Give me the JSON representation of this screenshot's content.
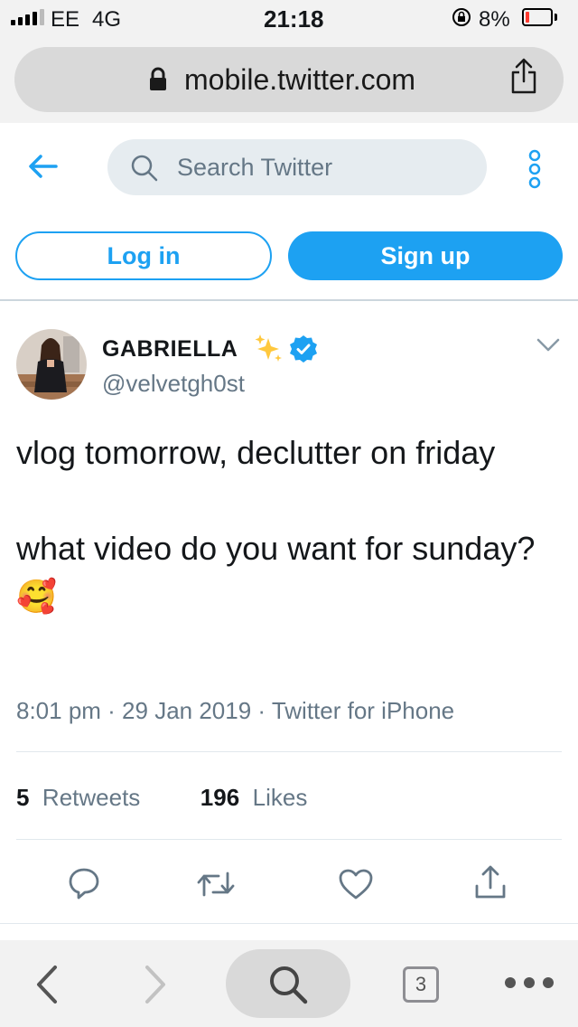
{
  "status_bar": {
    "carrier": "EE",
    "network": "4G",
    "time": "21:18",
    "battery": "8%"
  },
  "browser": {
    "url": "mobile.twitter.com",
    "tab_count": "3"
  },
  "header": {
    "search_placeholder": "Search Twitter",
    "login_label": "Log in",
    "signup_label": "Sign up"
  },
  "tweet": {
    "display_name": "GABRIELLA",
    "handle": "@velvetgh0st",
    "text": "vlog tomorrow, declutter on friday\n\nwhat video do you want for sunday?",
    "emoji": "🥰",
    "meta": "8:01 pm · 29 Jan 2019 · Twitter for iPhone",
    "retweets_count": "5",
    "retweets_label": "Retweets",
    "likes_count": "196",
    "likes_label": "Likes"
  },
  "colors": {
    "accent": "#1da1f2",
    "muted": "#657786",
    "text": "#14171a"
  },
  "icons": [
    "lock-icon",
    "share-icon",
    "back-arrow-icon",
    "search-icon",
    "more-vertical-icon",
    "sparkles-icon",
    "verified-badge-icon",
    "chevron-down-icon",
    "reply-icon",
    "retweet-icon",
    "like-icon",
    "share-tweet-icon",
    "browser-back-icon",
    "browser-forward-icon",
    "browser-search-icon",
    "browser-tabs-icon",
    "browser-more-icon"
  ]
}
